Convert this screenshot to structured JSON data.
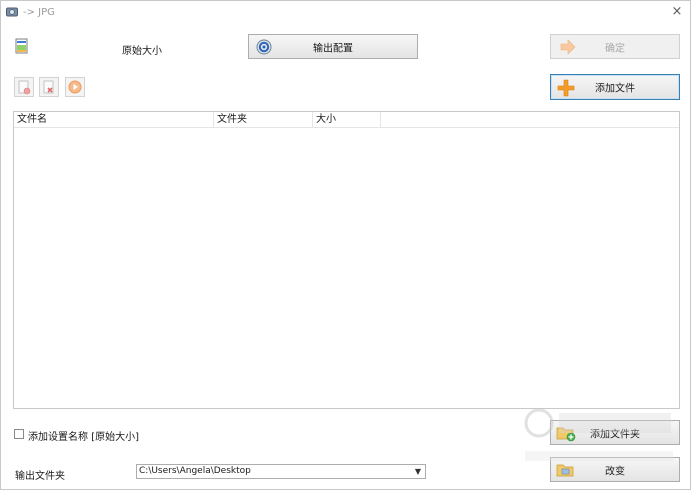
{
  "window": {
    "title": "-> JPG",
    "close_glyph": "×"
  },
  "size": {
    "label": "原始大小",
    "icon": "image-file-icon"
  },
  "buttons": {
    "output_config": "输出配置",
    "confirm": "确定",
    "add_file": "添加文件",
    "add_folder": "添加文件夹",
    "change": "改变"
  },
  "toolbar": {
    "items": [
      "add-page-icon",
      "remove-icon",
      "play-icon"
    ]
  },
  "file_list": {
    "columns": [
      "文件名",
      "文件夹",
      "大小"
    ],
    "rows": []
  },
  "options": {
    "add_setting_name_label": "添加设置名称 [原始大小]",
    "add_setting_name_checked": false
  },
  "output": {
    "label": "输出文件夹",
    "path": "C:\\Users\\Angela\\Desktop"
  },
  "colors": {
    "accent_orange": "#f39c2b",
    "focus_blue": "#3c7fb1"
  }
}
